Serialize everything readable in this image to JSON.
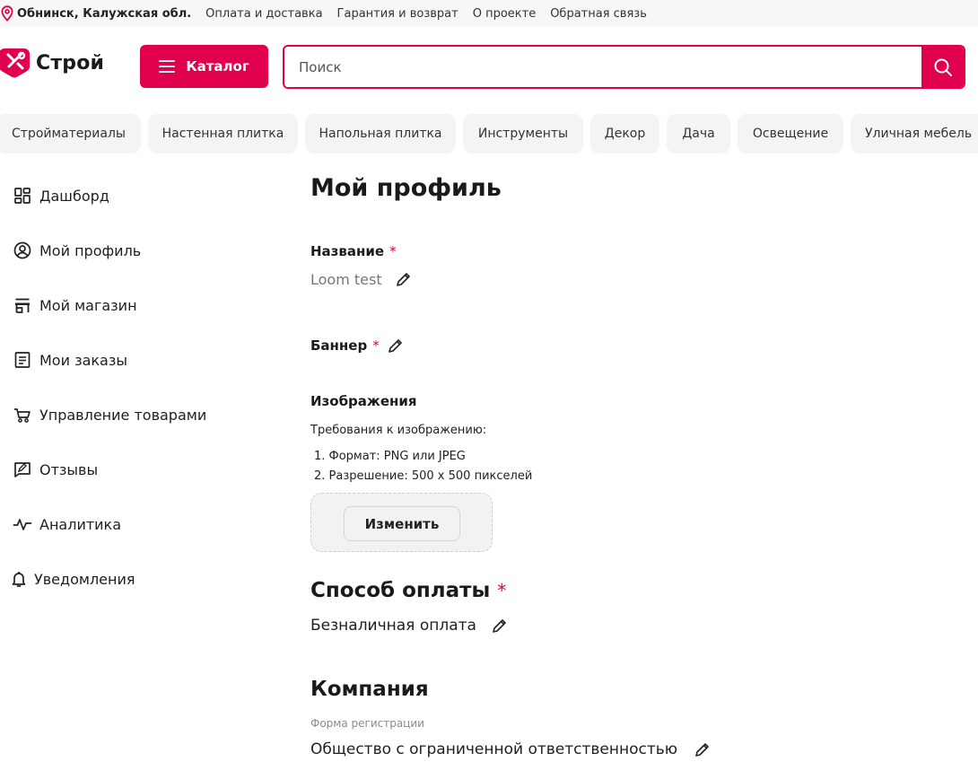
{
  "topbar": {
    "location": "Обнинск, Калужская обл.",
    "links": [
      "Оплата и доставка",
      "Гарантия и возврат",
      "О проекте",
      "Обратная связь"
    ]
  },
  "header": {
    "logo_text": "Строй",
    "catalog_label": "Каталог",
    "search_placeholder": "Поиск"
  },
  "categories": [
    "Стройматериалы",
    "Настенная плитка",
    "Напольная плитка",
    "Инструменты",
    "Декор",
    "Дача",
    "Освещение",
    "Уличная мебель"
  ],
  "sidebar": {
    "items": [
      {
        "label": "Дашборд",
        "icon": "dashboard-icon"
      },
      {
        "label": "Мой профиль",
        "icon": "user-circle-icon"
      },
      {
        "label": "Мой магазин",
        "icon": "store-icon"
      },
      {
        "label": "Мои заказы",
        "icon": "orders-list-icon"
      },
      {
        "label": "Управление товарами",
        "icon": "cart-icon"
      },
      {
        "label": "Отзывы",
        "icon": "review-icon"
      },
      {
        "label": "Аналитика",
        "icon": "pulse-icon"
      },
      {
        "label": "Уведомления",
        "icon": "bell-icon"
      }
    ]
  },
  "profile": {
    "title": "Мой профиль",
    "name_label": "Название",
    "name_value": "Loom test",
    "banner_label": "Баннер",
    "images_label": "Изображения",
    "requirements_title": "Требования к изображению:",
    "requirements": [
      "1. Формат: PNG или JPEG",
      "2. Разрешение: 500 х 500 пикселей"
    ],
    "change_button": "Изменить",
    "payment_title": "Способ оплаты",
    "payment_value": "Безналичная оплата",
    "company_title": "Компания",
    "registration_label": "Форма регистрации",
    "registration_value": "Общество с ограниченной ответственностью",
    "required_mark": "*"
  },
  "colors": {
    "accent": "#e0004d",
    "chip_bg": "#f4f4f4",
    "topbar_bg": "#f7f7f7"
  }
}
